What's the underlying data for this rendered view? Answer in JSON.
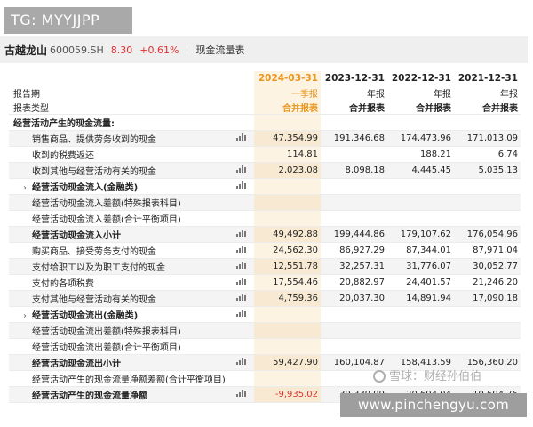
{
  "watermark_top": "TG: MYYJJPP",
  "header": {
    "name": "古越龙山",
    "code": "600059.SH",
    "price": "8.30",
    "change": "+0.61%",
    "page": "现金流量表"
  },
  "columns": {
    "dates": [
      "2024-03-31",
      "2023-12-31",
      "2022-12-31",
      "2021-12-31"
    ],
    "period_label": "报告期",
    "periods": [
      "一季报",
      "年报",
      "年报",
      "年报"
    ],
    "type_label": "报表类型",
    "types": [
      "合并报表",
      "合并报表",
      "合并报表",
      "合并报表"
    ]
  },
  "rows": [
    {
      "label": "经营活动产生的现金流量:",
      "kind": "section",
      "chart": false,
      "values": [
        "",
        "",
        "",
        ""
      ]
    },
    {
      "label": "销售商品、提供劳务收到的现金",
      "kind": "item",
      "chart": true,
      "values": [
        "47,354.99",
        "191,346.68",
        "174,473.96",
        "171,013.09"
      ]
    },
    {
      "label": "收到的税费返还",
      "kind": "item",
      "chart": false,
      "values": [
        "114.81",
        "",
        "188.21",
        "6.74"
      ]
    },
    {
      "label": "收到其他与经营活动有关的现金",
      "kind": "item",
      "chart": true,
      "values": [
        "2,023.08",
        "8,098.18",
        "4,445.45",
        "5,035.13"
      ]
    },
    {
      "label": "经营活动现金流入(金融类)",
      "kind": "expand",
      "chart": true,
      "values": [
        "",
        "",
        "",
        ""
      ]
    },
    {
      "label": "经营活动现金流入差额(特殊报表科目)",
      "kind": "item",
      "chart": false,
      "values": [
        "",
        "",
        "",
        ""
      ]
    },
    {
      "label": "经营活动现金流入差额(合计平衡项目)",
      "kind": "item",
      "chart": false,
      "values": [
        "",
        "",
        "",
        ""
      ]
    },
    {
      "label": "经营活动现金流入小计",
      "kind": "subtotal",
      "chart": true,
      "values": [
        "49,492.88",
        "199,444.86",
        "179,107.62",
        "176,054.96"
      ]
    },
    {
      "label": "购买商品、接受劳务支付的现金",
      "kind": "item",
      "chart": true,
      "values": [
        "24,562.30",
        "86,927.29",
        "87,344.01",
        "87,971.04"
      ]
    },
    {
      "label": "支付给职工以及为职工支付的现金",
      "kind": "item",
      "chart": true,
      "values": [
        "12,551.78",
        "32,257.31",
        "31,776.07",
        "30,052.77"
      ]
    },
    {
      "label": "支付的各项税费",
      "kind": "item",
      "chart": true,
      "values": [
        "17,554.46",
        "20,882.97",
        "24,401.57",
        "21,246.20"
      ]
    },
    {
      "label": "支付其他与经营活动有关的现金",
      "kind": "item",
      "chart": true,
      "values": [
        "4,759.36",
        "20,037.30",
        "14,891.94",
        "17,090.18"
      ]
    },
    {
      "label": "经营活动现金流出(金融类)",
      "kind": "expand",
      "chart": true,
      "values": [
        "",
        "",
        "",
        ""
      ]
    },
    {
      "label": "经营活动现金流出差额(特殊报表科目)",
      "kind": "item",
      "chart": false,
      "values": [
        "",
        "",
        "",
        ""
      ]
    },
    {
      "label": "经营活动现金流出差额(合计平衡项目)",
      "kind": "item",
      "chart": false,
      "values": [
        "",
        "",
        "",
        ""
      ]
    },
    {
      "label": "经营活动现金流出小计",
      "kind": "subtotal",
      "chart": true,
      "values": [
        "59,427.90",
        "160,104.87",
        "158,413.59",
        "156,360.20"
      ]
    },
    {
      "label": "经营活动产生的现金流量净额差额(合计平衡项目)",
      "kind": "item",
      "chart": false,
      "values": [
        "",
        "",
        "",
        ""
      ]
    },
    {
      "label": "经营活动产生的现金流量净额",
      "kind": "total",
      "chart": true,
      "values": [
        "-9,935.02",
        "39,339.99",
        "20,694.04",
        "19,694.76"
      ]
    }
  ],
  "watermark_xueqiu": "雪球：财经孙伯伯",
  "watermark_bottom": "www.pinchengyu.com"
}
